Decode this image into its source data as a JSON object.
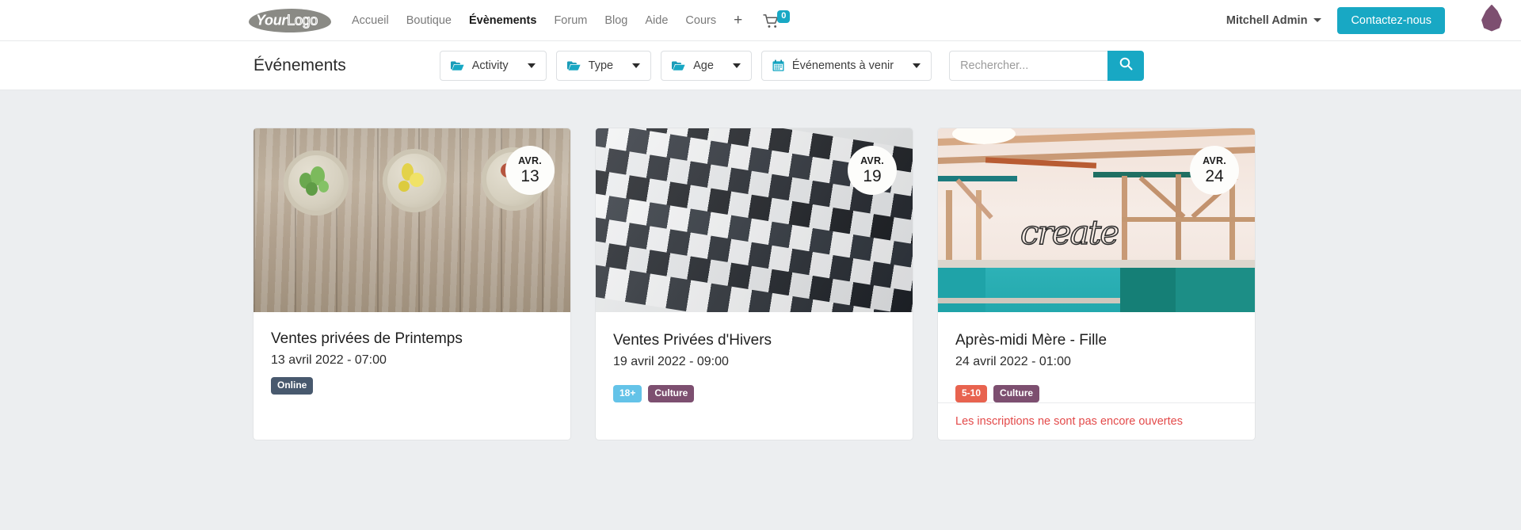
{
  "navbar": {
    "logo": {
      "part1": "Your",
      "part2": "Logo",
      "name": "YourLogo"
    },
    "links": [
      {
        "label": "Accueil",
        "active": false
      },
      {
        "label": "Boutique",
        "active": false
      },
      {
        "label": "Évènements",
        "active": true
      },
      {
        "label": "Forum",
        "active": false
      },
      {
        "label": "Blog",
        "active": false
      },
      {
        "label": "Aide",
        "active": false
      },
      {
        "label": "Cours",
        "active": false
      }
    ],
    "plus_label": "+",
    "cart": {
      "icon": "cart-icon",
      "count": "0"
    },
    "user": {
      "name": "Mitchell Admin"
    },
    "contact_button": "Contactez-nous",
    "accent_color": "#18a8c4",
    "drop_color": "#7d4f70"
  },
  "filterbar": {
    "title": "Événements",
    "filters": [
      {
        "icon": "folder-icon",
        "label": "Activity"
      },
      {
        "icon": "folder-icon",
        "label": "Type"
      },
      {
        "icon": "folder-icon",
        "label": "Age"
      },
      {
        "icon": "calendar-icon",
        "label": "Événements à venir"
      }
    ],
    "search": {
      "placeholder": "Rechercher...",
      "value": "",
      "button_icon": "search-icon"
    }
  },
  "events": [
    {
      "id": "ventes-privees-printemps",
      "date_month": "AVR.",
      "date_day": "13",
      "title": "Ventes privées de Printemps",
      "datetime": "13 avril 2022 - 07:00",
      "tags": [
        {
          "label": "Online",
          "color": "#48596e"
        }
      ],
      "footer_note": "",
      "image_alt": "succulents-on-wood"
    },
    {
      "id": "ventes-privees-hivers",
      "date_month": "AVR.",
      "date_day": "19",
      "title": "Ventes Privées d'Hivers",
      "datetime": "19 avril 2022 - 09:00",
      "tags": [
        {
          "label": "18+",
          "color": "#64c3e8"
        },
        {
          "label": "Culture",
          "color": "#7d4f70"
        }
      ],
      "footer_note": "",
      "image_alt": "black-white-architecture"
    },
    {
      "id": "apres-midi-mere-fille",
      "date_month": "AVR.",
      "date_day": "24",
      "title": "Après-midi Mère - Fille",
      "datetime": "24 avril 2022 - 01:00",
      "tags": [
        {
          "label": "5-10",
          "color": "#e8634f"
        },
        {
          "label": "Culture",
          "color": "#7d4f70"
        }
      ],
      "footer_note": "Les inscriptions ne sont pas encore ouvertes",
      "image_alt": "create-wall-interior"
    }
  ]
}
